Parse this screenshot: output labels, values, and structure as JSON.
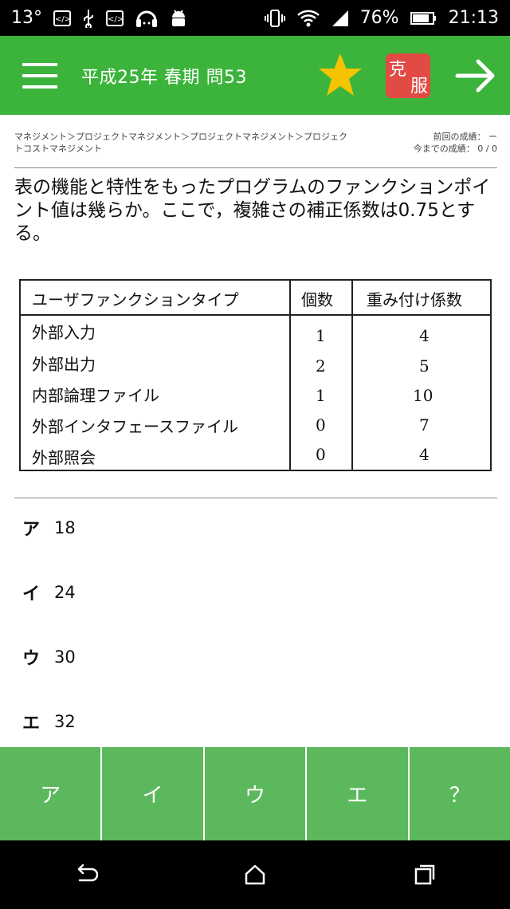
{
  "status_bar": {
    "temperature": "13°",
    "battery": "76%",
    "time": "21:13",
    "icons_left": [
      "code-icon",
      "usb-icon",
      "code-icon",
      "headset-icon",
      "android-icon"
    ],
    "icons_right": [
      "vibrate-icon",
      "wifi-icon",
      "signal-icon",
      "battery-icon"
    ]
  },
  "app_bar": {
    "title": "平成25年 春期 問53",
    "conquer_top": "克",
    "conquer_bottom": "服",
    "colors": {
      "bar": "#3cb43c",
      "star": "#f5c400",
      "conquer": "#e24a44"
    }
  },
  "breadcrumb": {
    "path_line1": "マネジメント＞プロジェクトマネジメント＞プロジェクトマネジメント＞プロジェク",
    "path_line2": "トコストマネジメント",
    "prev_score": "前回の成績：  ー",
    "total_score": "今までの成績：  0 / 0"
  },
  "question": "表の機能と特性をもったプログラムのファンクションポイント値は幾らか。ここで，複雑さの補正係数は0.75とする。",
  "table": {
    "headers": [
      "ユーザファンクションタイプ",
      "個数",
      "重み付け係数"
    ],
    "rows": [
      [
        "外部入力",
        "1",
        "4"
      ],
      [
        "外部出力",
        "2",
        "5"
      ],
      [
        "内部論理ファイル",
        "1",
        "10"
      ],
      [
        "外部インタフェースファイル",
        "0",
        "7"
      ],
      [
        "外部照会",
        "0",
        "4"
      ]
    ]
  },
  "choices": [
    {
      "label": "ア",
      "value": "18"
    },
    {
      "label": "イ",
      "value": "24"
    },
    {
      "label": "ウ",
      "value": "30"
    },
    {
      "label": "エ",
      "value": "32"
    }
  ],
  "answer_buttons": [
    "ア",
    "イ",
    "ウ",
    "エ",
    "？"
  ],
  "answer_button_color": "#5cb85c"
}
